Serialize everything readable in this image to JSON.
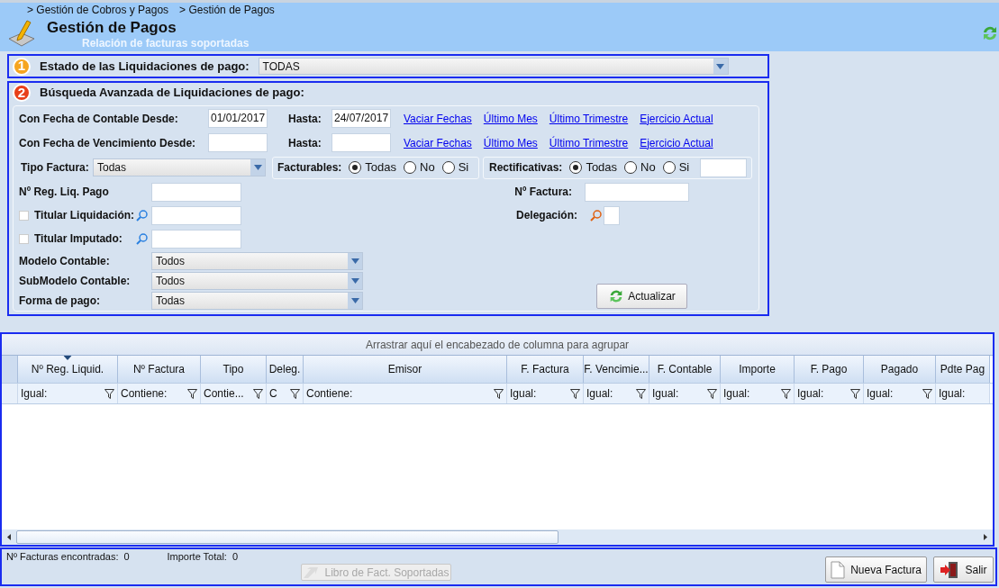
{
  "breadcrumb": [
    "> Gestión de Cobros y Pagos",
    "> Gestión de Pagos"
  ],
  "header": {
    "title": "Gestión de Pagos",
    "subtitle": "Relación de facturas soportadas"
  },
  "estado": {
    "number": "1",
    "label": "Estado de las Liquidaciones de pago:",
    "value": "TODAS"
  },
  "busqueda": {
    "number": "2",
    "title": "Búsqueda Avanzada de Liquidaciones de pago:"
  },
  "date_rows": [
    {
      "label": "Con Fecha de Contable Desde:",
      "from": "01/01/2017",
      "to_label": "Hasta:",
      "to": "24/07/2017",
      "links": [
        "Vaciar Fechas",
        "Último Mes",
        "Último Trimestre",
        "Ejercicio Actual"
      ]
    },
    {
      "label": "Con Fecha de Vencimiento Desde:",
      "to_label": "Hasta:",
      "links": [
        "Vaciar Fechas",
        "Último Mes",
        "Último Trimestre",
        "Ejercicio Actual"
      ]
    }
  ],
  "tipo_factura": {
    "label": "Tipo Factura:",
    "value": "Todas"
  },
  "facturables": {
    "label": "Facturables:",
    "options": [
      {
        "label": "Todas",
        "selected": true
      },
      {
        "label": "No",
        "selected": false
      },
      {
        "label": "Si",
        "selected": false
      }
    ]
  },
  "rectificativas": {
    "label": "Rectificativas:",
    "options": [
      {
        "label": "Todas",
        "selected": true
      },
      {
        "label": "No",
        "selected": false
      },
      {
        "label": "Si",
        "selected": false
      }
    ]
  },
  "reg_liq": {
    "label": "Nº Reg. Liq. Pago"
  },
  "nro_factura": {
    "label": "Nº Factura:"
  },
  "titulares": [
    {
      "label": "Titular Liquidación:",
      "checked": false
    },
    {
      "label": "Titular Imputado:",
      "checked": false
    }
  ],
  "delegacion": {
    "label": "Delegación:"
  },
  "dropdowns": [
    {
      "label": "Modelo Contable:",
      "value": "Todos"
    },
    {
      "label": "SubModelo Contable:",
      "value": "Todos"
    },
    {
      "label": "Forma de pago:",
      "value": "Todas"
    }
  ],
  "actualizar": "Actualizar",
  "grid": {
    "group_hint": "Arrastrar aquí el encabezado de columna para agrupar",
    "columns": [
      {
        "header": "Nº Reg. Liquid.",
        "filter": "Igual:",
        "sorted": true
      },
      {
        "header": "Nº Factura",
        "filter": "Contiene:",
        "sorted": false
      },
      {
        "header": "Tipo",
        "filter": "Contie...",
        "sorted": false
      },
      {
        "header": "Deleg.",
        "filter": "C",
        "sorted": false
      },
      {
        "header": "Emisor",
        "filter": "Contiene:",
        "sorted": false
      },
      {
        "header": "F. Factura",
        "filter": "Igual:",
        "sorted": false
      },
      {
        "header": "F. Vencimie...",
        "filter": "Igual:",
        "sorted": false
      },
      {
        "header": "F. Contable",
        "filter": "Igual:",
        "sorted": false
      },
      {
        "header": "Importe",
        "filter": "Igual:",
        "sorted": false
      },
      {
        "header": "F. Pago",
        "filter": "Igual:",
        "sorted": false
      },
      {
        "header": "Pagado",
        "filter": "Igual:",
        "sorted": false
      },
      {
        "header": "Pdte Pag",
        "filter": "Igual:",
        "sorted": false
      }
    ]
  },
  "footer": {
    "found_label": "Nº Facturas encontradas:",
    "found": "0",
    "total_label": "Importe Total:",
    "total": "0"
  },
  "buttons": [
    {
      "kind": "libro",
      "label": "Libro de Fact. Soportadas",
      "disabled": true
    },
    {
      "kind": "nueva",
      "label": "Nueva Factura",
      "disabled": false
    },
    {
      "kind": "salir",
      "label": "Salir",
      "disabled": false
    }
  ]
}
